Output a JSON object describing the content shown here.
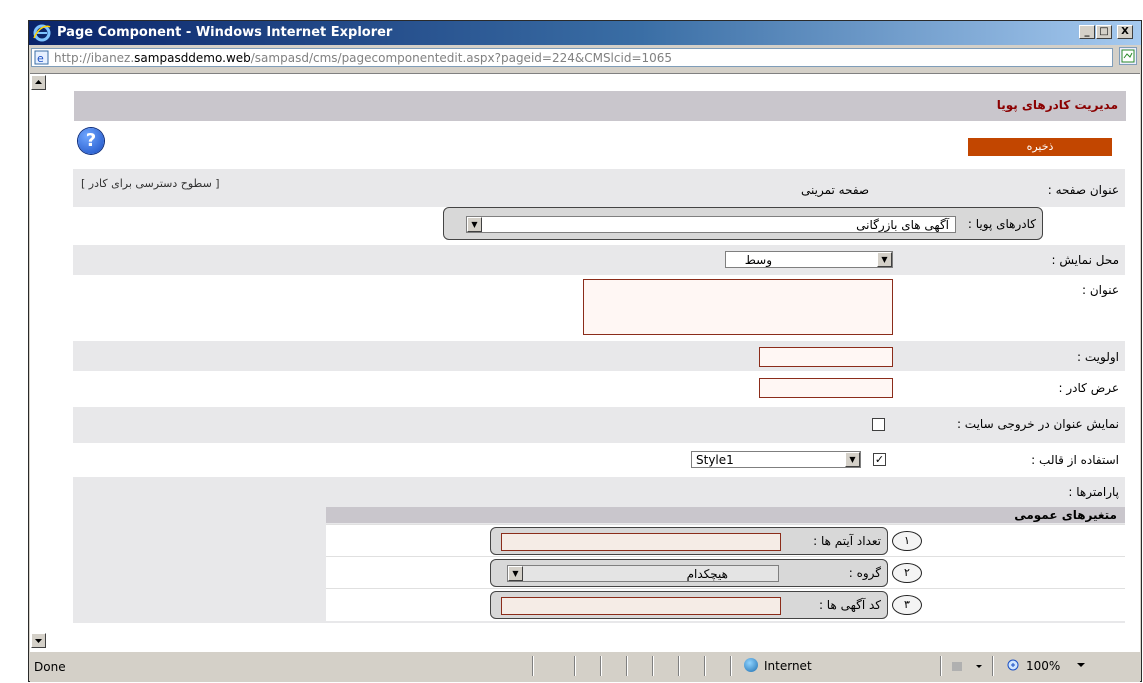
{
  "window": {
    "title": "Page Component - Windows Internet Explorer",
    "minimize": "_",
    "maximize": "□",
    "close": "X",
    "url_prefix": "http://ibanez.",
    "url_host": "sampasddemo.web",
    "url_rest": "/sampasd/cms/pagecomponentedit.aspx?pageid=224&CMSlcid=1065"
  },
  "page": {
    "header_title": "مدیریت کادرهای پویا",
    "save_label": "ذخیره",
    "help_symbol": "?",
    "access_link": "[ سطوح دسترسی برای کادر ]",
    "fields": {
      "page_title_label": "عنوان صفحه :",
      "page_title_value": "صفحه تمرینی",
      "dynamic_frames_label": "کادرهای پویا :",
      "dynamic_frames_value": "آگهی های بازرگانی",
      "display_location_label": "محل نمایش :",
      "display_location_value": "وسط",
      "title_label": "عنوان :",
      "title_value": "",
      "priority_label": "اولویت :",
      "priority_value": "",
      "frame_width_label": "عرض کادر :",
      "frame_width_value": "",
      "show_title_label": "نمایش عنوان در خروجی سایت :",
      "show_title_checked": false,
      "use_template_label": "استفاده از قالب :",
      "use_template_checked": true,
      "template_value": "Style1",
      "parameters_label": "پارامترها :"
    },
    "parameters": {
      "header": "متغیرهای عمومی",
      "items": [
        {
          "num": "١",
          "label": "تعداد آیتم ها :",
          "value": ""
        },
        {
          "num": "٢",
          "label": "گروه :",
          "value": "هیچکدام"
        },
        {
          "num": "٣",
          "label": "کد آگهی ها :",
          "value": ""
        }
      ]
    }
  },
  "status": {
    "text": "Done",
    "zone": "Internet",
    "zoom": "100%"
  },
  "icons": [
    "ie-logo-icon",
    "page-icon",
    "go-icon",
    "help-icon",
    "globe-icon",
    "scroll-up-icon",
    "scroll-down-icon",
    "dropdown-arrow-icon"
  ]
}
